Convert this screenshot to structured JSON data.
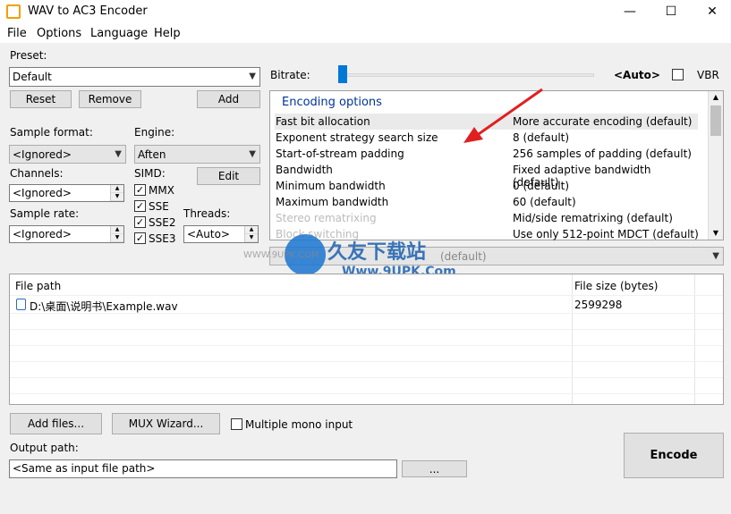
{
  "window": {
    "title": "WAV to AC3 Encoder"
  },
  "menu": [
    "File",
    "Options",
    "Language",
    "Help"
  ],
  "preset": {
    "label": "Preset:",
    "value": "Default",
    "reset": "Reset",
    "remove": "Remove",
    "add": "Add"
  },
  "sample_format": {
    "label": "Sample format:",
    "value": "<Ignored>"
  },
  "engine": {
    "label": "Engine:",
    "value": "Aften",
    "edit": "Edit"
  },
  "channels": {
    "label": "Channels:",
    "value": "<Ignored>"
  },
  "simd": {
    "label": "SIMD:",
    "items": [
      "MMX",
      "SSE",
      "SSE2",
      "SSE3"
    ]
  },
  "sample_rate": {
    "label": "Sample rate:",
    "value": "<Ignored>"
  },
  "threads": {
    "label": "Threads:",
    "value": "<Auto>"
  },
  "bitrate": {
    "label": "Bitrate:",
    "value": "<Auto>",
    "vbr": "VBR"
  },
  "encoding": {
    "header": "Encoding options",
    "rows": [
      {
        "name": "Fast bit allocation",
        "value": "More accurate encoding (default)"
      },
      {
        "name": "Exponent strategy search size",
        "value": "8 (default)"
      },
      {
        "name": "Start-of-stream padding",
        "value": "256 samples of padding (default)"
      },
      {
        "name": "Bandwidth",
        "value": "Fixed adaptive bandwidth (default)"
      },
      {
        "name": "Minimum bandwidth",
        "value": "0 (default)"
      },
      {
        "name": "Maximum bandwidth",
        "value": "60 (default)"
      },
      {
        "name": "Stereo rematrixing",
        "value": "Mid/side rematrixing (default)"
      },
      {
        "name": "Block switching",
        "value": "Use only 512-point MDCT (default)"
      }
    ],
    "option_select": "(default)"
  },
  "files": {
    "col_path": "File path",
    "col_size": "File size (bytes)",
    "rows": [
      {
        "path": "D:\\桌面\\说明书\\Example.wav",
        "size": "2599298"
      }
    ]
  },
  "actions": {
    "add_files": "Add files...",
    "mux": "MUX Wizard...",
    "multiple_mono": "Multiple mono input",
    "encode": "Encode"
  },
  "output": {
    "label": "Output path:",
    "value": "<Same as input file path>",
    "browse": "..."
  },
  "watermark": {
    "site": "久友下载站",
    "url": "WWW.9UPK.COM",
    "url2": "Www.9UPK.Com"
  }
}
